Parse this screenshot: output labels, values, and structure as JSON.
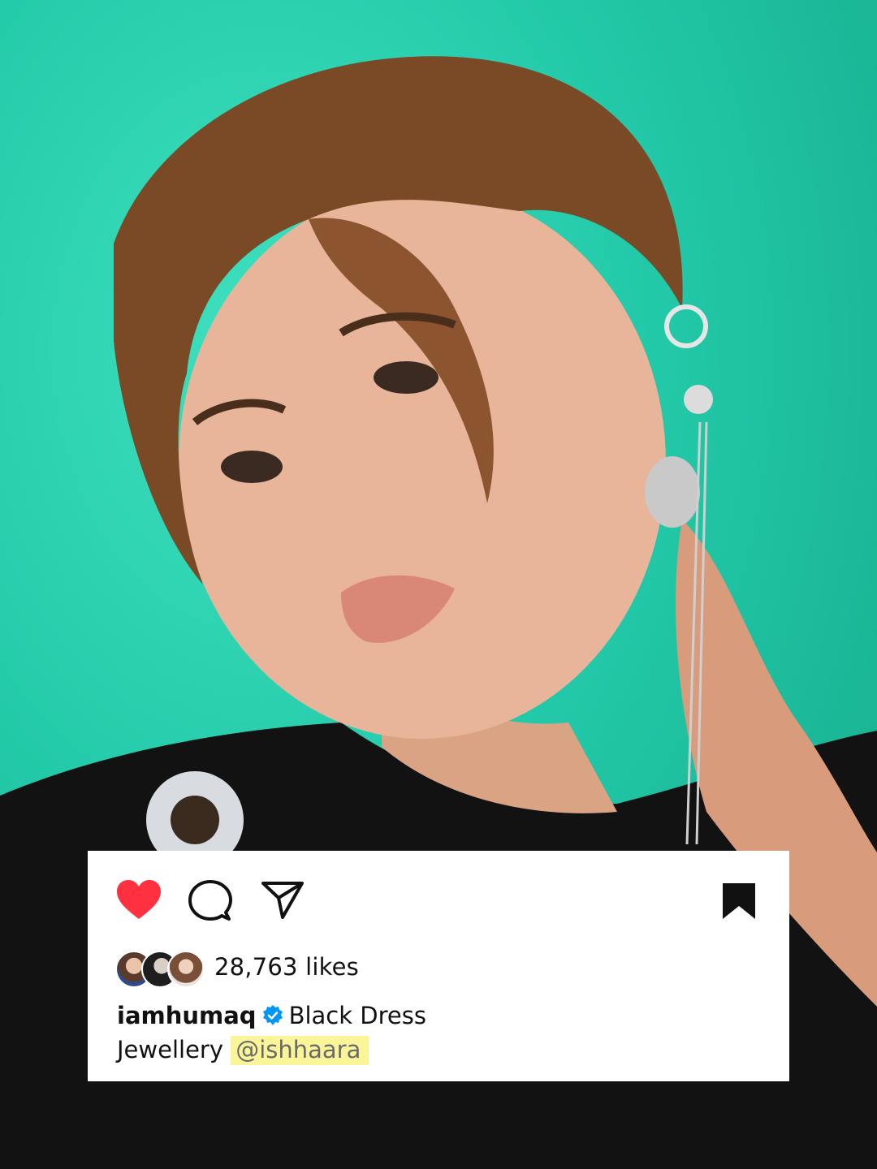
{
  "post": {
    "likes_text": "28,763 likes",
    "username": "iamhumaq",
    "caption_title": "Black Dress",
    "caption_line2_prefix": "Jewellery",
    "mention": "@ishhaara",
    "liked": true,
    "saved": true
  },
  "icons": {
    "like": "heart-icon",
    "comment": "comment-icon",
    "share": "send-icon",
    "save": "bookmark-icon",
    "verified": "verified-badge-icon"
  },
  "colors": {
    "background_teal": "#22c9a8",
    "heart_red": "#ff3040",
    "verified_blue": "#0095f6",
    "mention_highlight": "#fbf59a"
  }
}
